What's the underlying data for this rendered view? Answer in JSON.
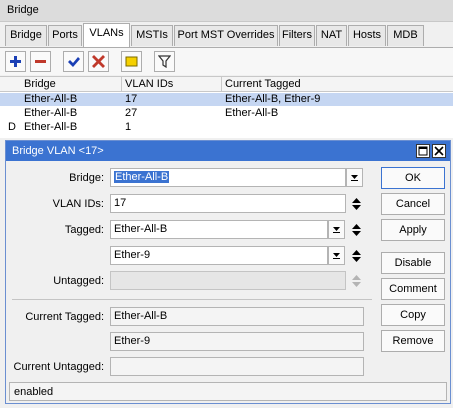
{
  "window": {
    "title": "Bridge"
  },
  "tabs": [
    {
      "label": "Bridge"
    },
    {
      "label": "Ports"
    },
    {
      "label": "VLANs"
    },
    {
      "label": "MSTIs"
    },
    {
      "label": "Port MST Overrides"
    },
    {
      "label": "Filters"
    },
    {
      "label": "NAT"
    },
    {
      "label": "Hosts"
    },
    {
      "label": "MDB"
    }
  ],
  "active_tab": "VLANs",
  "toolbar": {
    "buttons": [
      {
        "icon": "plus-icon",
        "color": "#1a3fb5"
      },
      {
        "icon": "minus-icon",
        "color": "#c0392b"
      },
      {
        "icon": "check-icon",
        "color": "#1a3fb5"
      },
      {
        "icon": "x-icon",
        "color": "#c0392b"
      },
      {
        "icon": "comment-icon",
        "color": "#f5d000"
      },
      {
        "icon": "filter-icon",
        "color": "#333333"
      }
    ]
  },
  "table": {
    "columns": [
      "Bridge",
      "VLAN IDs",
      "Current Tagged"
    ],
    "rows": [
      {
        "flag": "",
        "bridge": "Ether-All-B",
        "vlan_ids": "17",
        "current_tagged": "Ether-All-B, Ether-9",
        "selected": true
      },
      {
        "flag": "",
        "bridge": "Ether-All-B",
        "vlan_ids": "27",
        "current_tagged": "Ether-All-B",
        "selected": false
      },
      {
        "flag": "D",
        "bridge": "Ether-All-B",
        "vlan_ids": "1",
        "current_tagged": "",
        "selected": false
      }
    ]
  },
  "dialog": {
    "title": "Bridge VLAN <17>",
    "fields": {
      "bridge_label": "Bridge:",
      "bridge_value": "Ether-All-B",
      "vlan_ids_label": "VLAN IDs:",
      "vlan_ids_value": "17",
      "tagged_label": "Tagged:",
      "tagged_values": [
        "Ether-All-B",
        "Ether-9"
      ],
      "untagged_label": "Untagged:",
      "untagged_value": "",
      "current_tagged_label": "Current Tagged:",
      "current_tagged_values": [
        "Ether-All-B",
        "Ether-9"
      ],
      "current_untagged_label": "Current Untagged:",
      "current_untagged_value": ""
    },
    "buttons": {
      "ok": "OK",
      "cancel": "Cancel",
      "apply": "Apply",
      "disable": "Disable",
      "comment": "Comment",
      "copy": "Copy",
      "remove": "Remove"
    },
    "status": "enabled"
  },
  "colors": {
    "dialog_titlebar": "#3b73d1",
    "selection": "#c5d6f2"
  }
}
